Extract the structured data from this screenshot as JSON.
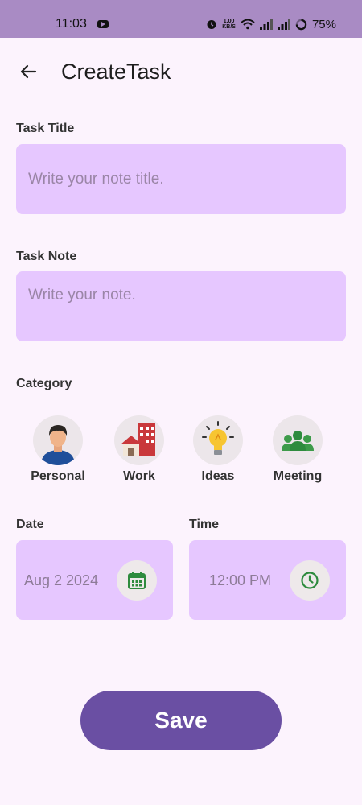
{
  "status_bar": {
    "time": "11:03",
    "speed_value": "1.00",
    "speed_unit": "KB/S",
    "battery": "75%"
  },
  "app_bar": {
    "title": "CreateTask"
  },
  "form": {
    "task_title": {
      "label": "Task Title",
      "value": "",
      "placeholder": "Write your note title."
    },
    "task_note": {
      "label": "Task Note",
      "value": "",
      "placeholder": "Write your note."
    },
    "category": {
      "label": "Category",
      "items": [
        {
          "label": "Personal",
          "icon": "person-icon"
        },
        {
          "label": "Work",
          "icon": "buildings-icon"
        },
        {
          "label": "Ideas",
          "icon": "lightbulb-icon"
        },
        {
          "label": "Meeting",
          "icon": "group-icon"
        }
      ]
    },
    "date": {
      "label": "Date",
      "value": "Aug 2 2024",
      "icon": "calendar-icon"
    },
    "time": {
      "label": "Time",
      "value": "12:00 PM",
      "icon": "clock-icon"
    }
  },
  "actions": {
    "save_label": "Save"
  },
  "colors": {
    "background": "#fcf3fd",
    "status_bar": "#a98bc4",
    "field_fill": "#e6c7ff",
    "primary": "#6a4fa3",
    "icon_green": "#2e8b3e"
  }
}
